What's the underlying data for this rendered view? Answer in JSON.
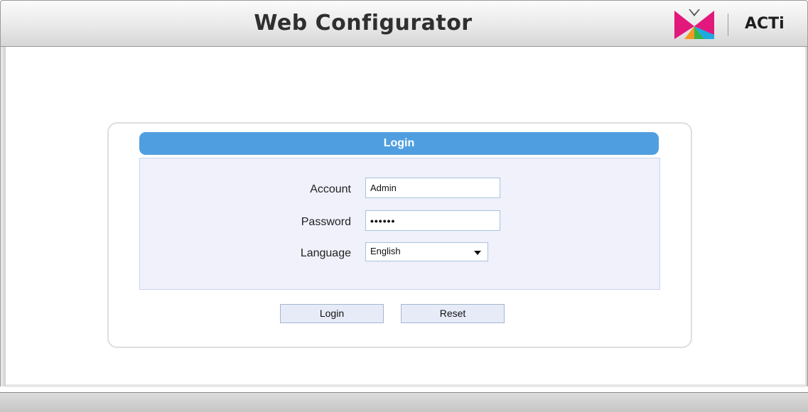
{
  "header": {
    "title": "Web Configurator",
    "brand": "ACTi",
    "logo_icon": "acti-butterfly-logo"
  },
  "login": {
    "banner_title": "Login",
    "account": {
      "label": "Account",
      "value": "Admin"
    },
    "password": {
      "label": "Password",
      "masked_value": "••••••"
    },
    "language": {
      "label": "Language",
      "selected": "English"
    },
    "buttons": {
      "login_label": "Login",
      "reset_label": "Reset"
    }
  },
  "colors": {
    "banner": "#4f9fe0",
    "form_background": "#f0f1fb",
    "button_background": "#e7ebf8",
    "logo_magenta": "#e2187c",
    "logo_orange": "#f39a1e",
    "logo_green": "#37b34a",
    "logo_cyan": "#1fa9e1"
  }
}
